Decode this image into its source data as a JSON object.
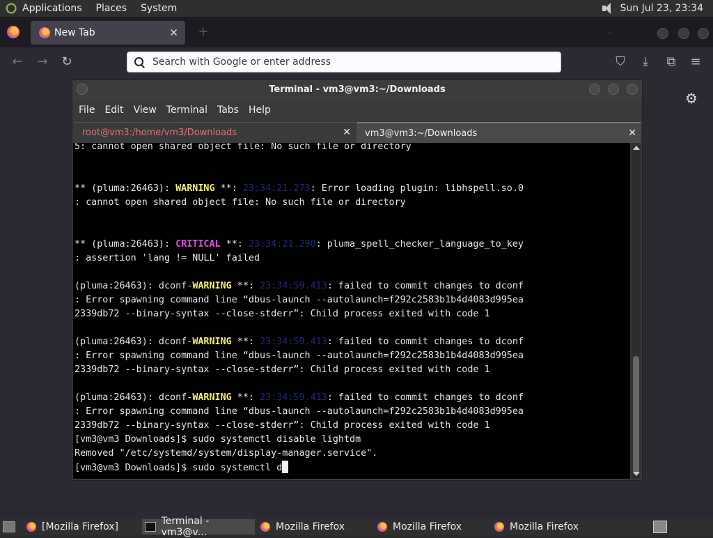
{
  "top_panel": {
    "menus": [
      "Applications",
      "Places",
      "System"
    ],
    "clock": "Sun Jul 23, 23:34"
  },
  "firefox": {
    "tab_label": "New Tab",
    "tab_close": "✕",
    "new_tab": "+",
    "url_placeholder": "Search with Google or enter address",
    "nav": {
      "back": "←",
      "forward": "→",
      "reload": "↻",
      "pocket": "⛉",
      "download": "⤓",
      "extensions": "⧉",
      "menu": "≡"
    },
    "gear": "⚙"
  },
  "terminal": {
    "title": "Terminal - vm3@vm3:~/Downloads",
    "menu": [
      "File",
      "Edit",
      "View",
      "Terminal",
      "Tabs",
      "Help"
    ],
    "tabs": [
      {
        "label": "root@vm3:/home/vm3/Downloads",
        "close": "✕"
      },
      {
        "label": "vm3@vm3:~/Downloads",
        "close": "✕"
      }
    ],
    "lines": [
      [
        {
          "t": "5: cannot open shared object file: No such file or directory"
        }
      ],
      [],
      [],
      [
        {
          "t": "** (pluma:26463): "
        },
        {
          "t": "WARNING",
          "c": "warn"
        },
        {
          "t": " **: "
        },
        {
          "t": "23:34:21.273",
          "c": "ts"
        },
        {
          "t": ": Error loading plugin: libhspell.so.0"
        }
      ],
      [
        {
          "t": ": cannot open shared object file: No such file or directory"
        }
      ],
      [],
      [],
      [
        {
          "t": "** (pluma:26463): "
        },
        {
          "t": "CRITICAL",
          "c": "crit"
        },
        {
          "t": " **: "
        },
        {
          "t": "23:34:21.290",
          "c": "ts"
        },
        {
          "t": ": pluma_spell_checker_language_to_key"
        }
      ],
      [
        {
          "t": ": assertion 'lang != NULL' failed"
        }
      ],
      [],
      [
        {
          "t": "(pluma:26463): dconf-"
        },
        {
          "t": "WARNING",
          "c": "warn"
        },
        {
          "t": " **: "
        },
        {
          "t": "23:34:59.413",
          "c": "ts"
        },
        {
          "t": ": failed to commit changes to dconf"
        }
      ],
      [
        {
          "t": ": Error spawning command line “dbus-launch --autolaunch=f292c2583b1b4d4083d995ea"
        }
      ],
      [
        {
          "t": "2339db72 --binary-syntax --close-stderr”: Child process exited with code 1"
        }
      ],
      [],
      [
        {
          "t": "(pluma:26463): dconf-"
        },
        {
          "t": "WARNING",
          "c": "warn"
        },
        {
          "t": " **: "
        },
        {
          "t": "23:34:59.413",
          "c": "ts"
        },
        {
          "t": ": failed to commit changes to dconf"
        }
      ],
      [
        {
          "t": ": Error spawning command line “dbus-launch --autolaunch=f292c2583b1b4d4083d995ea"
        }
      ],
      [
        {
          "t": "2339db72 --binary-syntax --close-stderr”: Child process exited with code 1"
        }
      ],
      [],
      [
        {
          "t": "(pluma:26463): dconf-"
        },
        {
          "t": "WARNING",
          "c": "warn"
        },
        {
          "t": " **: "
        },
        {
          "t": "23:34:59.413",
          "c": "ts"
        },
        {
          "t": ": failed to commit changes to dconf"
        }
      ],
      [
        {
          "t": ": Error spawning command line “dbus-launch --autolaunch=f292c2583b1b4d4083d995ea"
        }
      ],
      [
        {
          "t": "2339db72 --binary-syntax --close-stderr”: Child process exited with code 1"
        }
      ],
      [
        {
          "t": "[vm3@vm3 Downloads]$ sudo systemctl disable lightdm"
        }
      ],
      [
        {
          "t": "Removed \"/etc/systemd/system/display-manager.service\"."
        }
      ],
      [
        {
          "t": "[vm3@vm3 Downloads]$ sudo systemctl d"
        },
        {
          "cursor": true
        }
      ]
    ]
  },
  "taskbar": {
    "items": [
      {
        "label": "[Mozilla Firefox]",
        "icon": "firefox-icon"
      },
      {
        "label": "Terminal - vm3@v...",
        "icon": "terminal-icon"
      },
      {
        "label": "Mozilla Firefox",
        "icon": "firefox-icon"
      },
      {
        "label": "Mozilla Firefox",
        "icon": "firefox-icon"
      },
      {
        "label": "Mozilla Firefox",
        "icon": "firefox-icon"
      }
    ]
  }
}
